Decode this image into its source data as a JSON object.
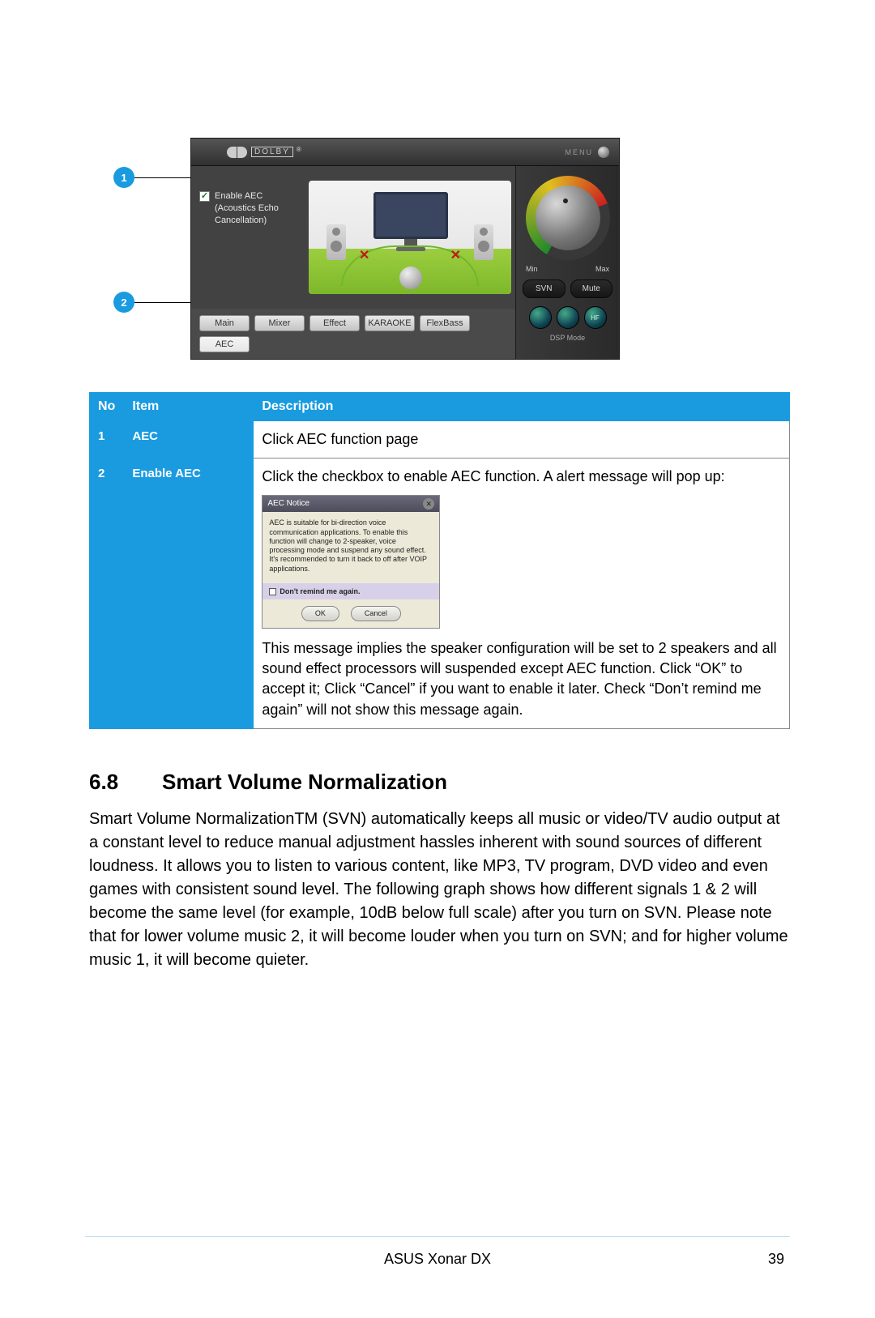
{
  "callouts": {
    "one": "1",
    "two": "2"
  },
  "app": {
    "dolby_text": "DOLBY",
    "menu_label": "MENU",
    "enable_aec_label": "Enable AEC (Acoustics Echo Cancellation)",
    "min": "Min",
    "max": "Max",
    "svn_btn": "SVN",
    "mute_btn": "Mute",
    "led1": "",
    "led2": "",
    "led3": "HF",
    "dsp": "DSP Mode",
    "tabs": {
      "main": "Main",
      "mixer": "Mixer",
      "effect": "Effect",
      "karaoke": "KARAOKE",
      "flexbass": "FlexBass",
      "aec": "AEC"
    }
  },
  "table": {
    "h_no": "No",
    "h_item": "Item",
    "h_desc": "Description",
    "r1_no": "1",
    "r1_item": "AEC",
    "r1_desc": "Click AEC function page",
    "r2_no": "2",
    "r2_item": "Enable AEC",
    "r2_desc_a": "Click the checkbox to enable AEC function. A alert message will pop up:",
    "r2_desc_b": "This message implies the speaker configuration will be set to 2 speakers and all sound effect processors will suspended except AEC function. Click “OK” to accept it; Click “Cancel” if you want to enable it later. Check “Don’t remind me again” will not show this message again."
  },
  "dialog": {
    "title": "AEC Notice",
    "body": "AEC is suitable for bi-direction voice communication applications. To enable this function will change to 2-speaker, voice processing mode and suspend any sound effect. It's recommended to turn it back to off after VOIP applications.",
    "remind": "Don't remind me again.",
    "ok": "OK",
    "cancel": "Cancel"
  },
  "section": {
    "num": "6.8",
    "title": "Smart Volume Normalization"
  },
  "body_para": "Smart Volume NormalizationTM (SVN) automatically keeps all music or video/TV audio output at a constant level to reduce manual adjustment hassles inherent with sound sources of different loudness. It allows you to listen to various content, like MP3, TV program, DVD video and even games with consistent sound level. The following graph shows how different signals 1 & 2 will become the same level (for example, 10dB below full scale) after you turn on SVN. Please note that for lower volume music 2, it will become louder when you turn on SVN; and for higher volume music 1, it will become quieter.",
  "footer": "ASUS Xonar DX",
  "page": "39"
}
